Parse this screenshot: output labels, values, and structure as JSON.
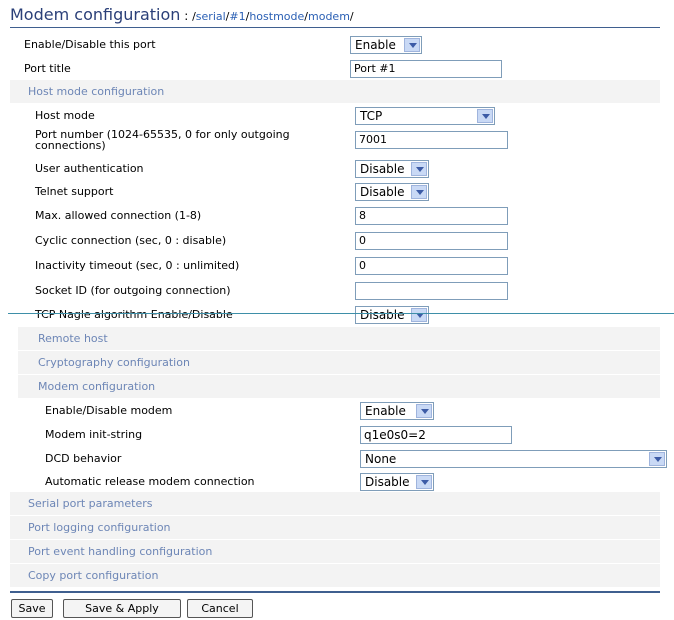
{
  "header": {
    "title": "Modem configuration",
    "separator": " : ",
    "path": [
      "serial",
      "#1",
      "hostmode",
      "modem"
    ]
  },
  "port": {
    "enable_label": "Enable/Disable this port",
    "enable_value": "Enable",
    "title_label": "Port title",
    "title_value": "Port #1"
  },
  "hostmode": {
    "section": "Host mode configuration",
    "host_mode_label": "Host mode",
    "host_mode_value": "TCP",
    "port_number_label_1": "Port number (1024-65535, 0 for only outgoing",
    "port_number_label_2": "connections)",
    "port_number_value": "7001",
    "auth_label": "User authentication",
    "auth_value": "Disable",
    "telnet_label": "Telnet support",
    "telnet_value": "Disable",
    "max_conn_label": "Max. allowed connection (1-8)",
    "max_conn_value": "8",
    "cyclic_label": "Cyclic connection (sec, 0 : disable)",
    "cyclic_value": "0",
    "inactivity_label": "Inactivity timeout (sec, 0 : unlimited)",
    "inactivity_value": "0",
    "socket_label": "Socket ID (for outgoing connection)",
    "socket_value": "",
    "nagle_label": "TCP Nagle algorithm Enable/Disable",
    "nagle_value": "Disable"
  },
  "subsections": {
    "remote_host": "Remote host",
    "crypto": "Cryptography configuration",
    "modem": "Modem configuration"
  },
  "modem": {
    "enable_label": "Enable/Disable modem",
    "enable_value": "Enable",
    "init_label": "Modem init-string",
    "init_value": "q1e0s0=2",
    "dcd_label": "DCD behavior",
    "dcd_value": "None",
    "release_label": "Automatic release modem connection",
    "release_value": "Disable"
  },
  "bottom_sections": {
    "serial": "Serial port parameters",
    "logging": "Port logging configuration",
    "event": "Port event handling configuration",
    "copy": "Copy port configuration"
  },
  "buttons": {
    "save": "Save",
    "save_apply": "Save & Apply",
    "cancel": "Cancel"
  }
}
